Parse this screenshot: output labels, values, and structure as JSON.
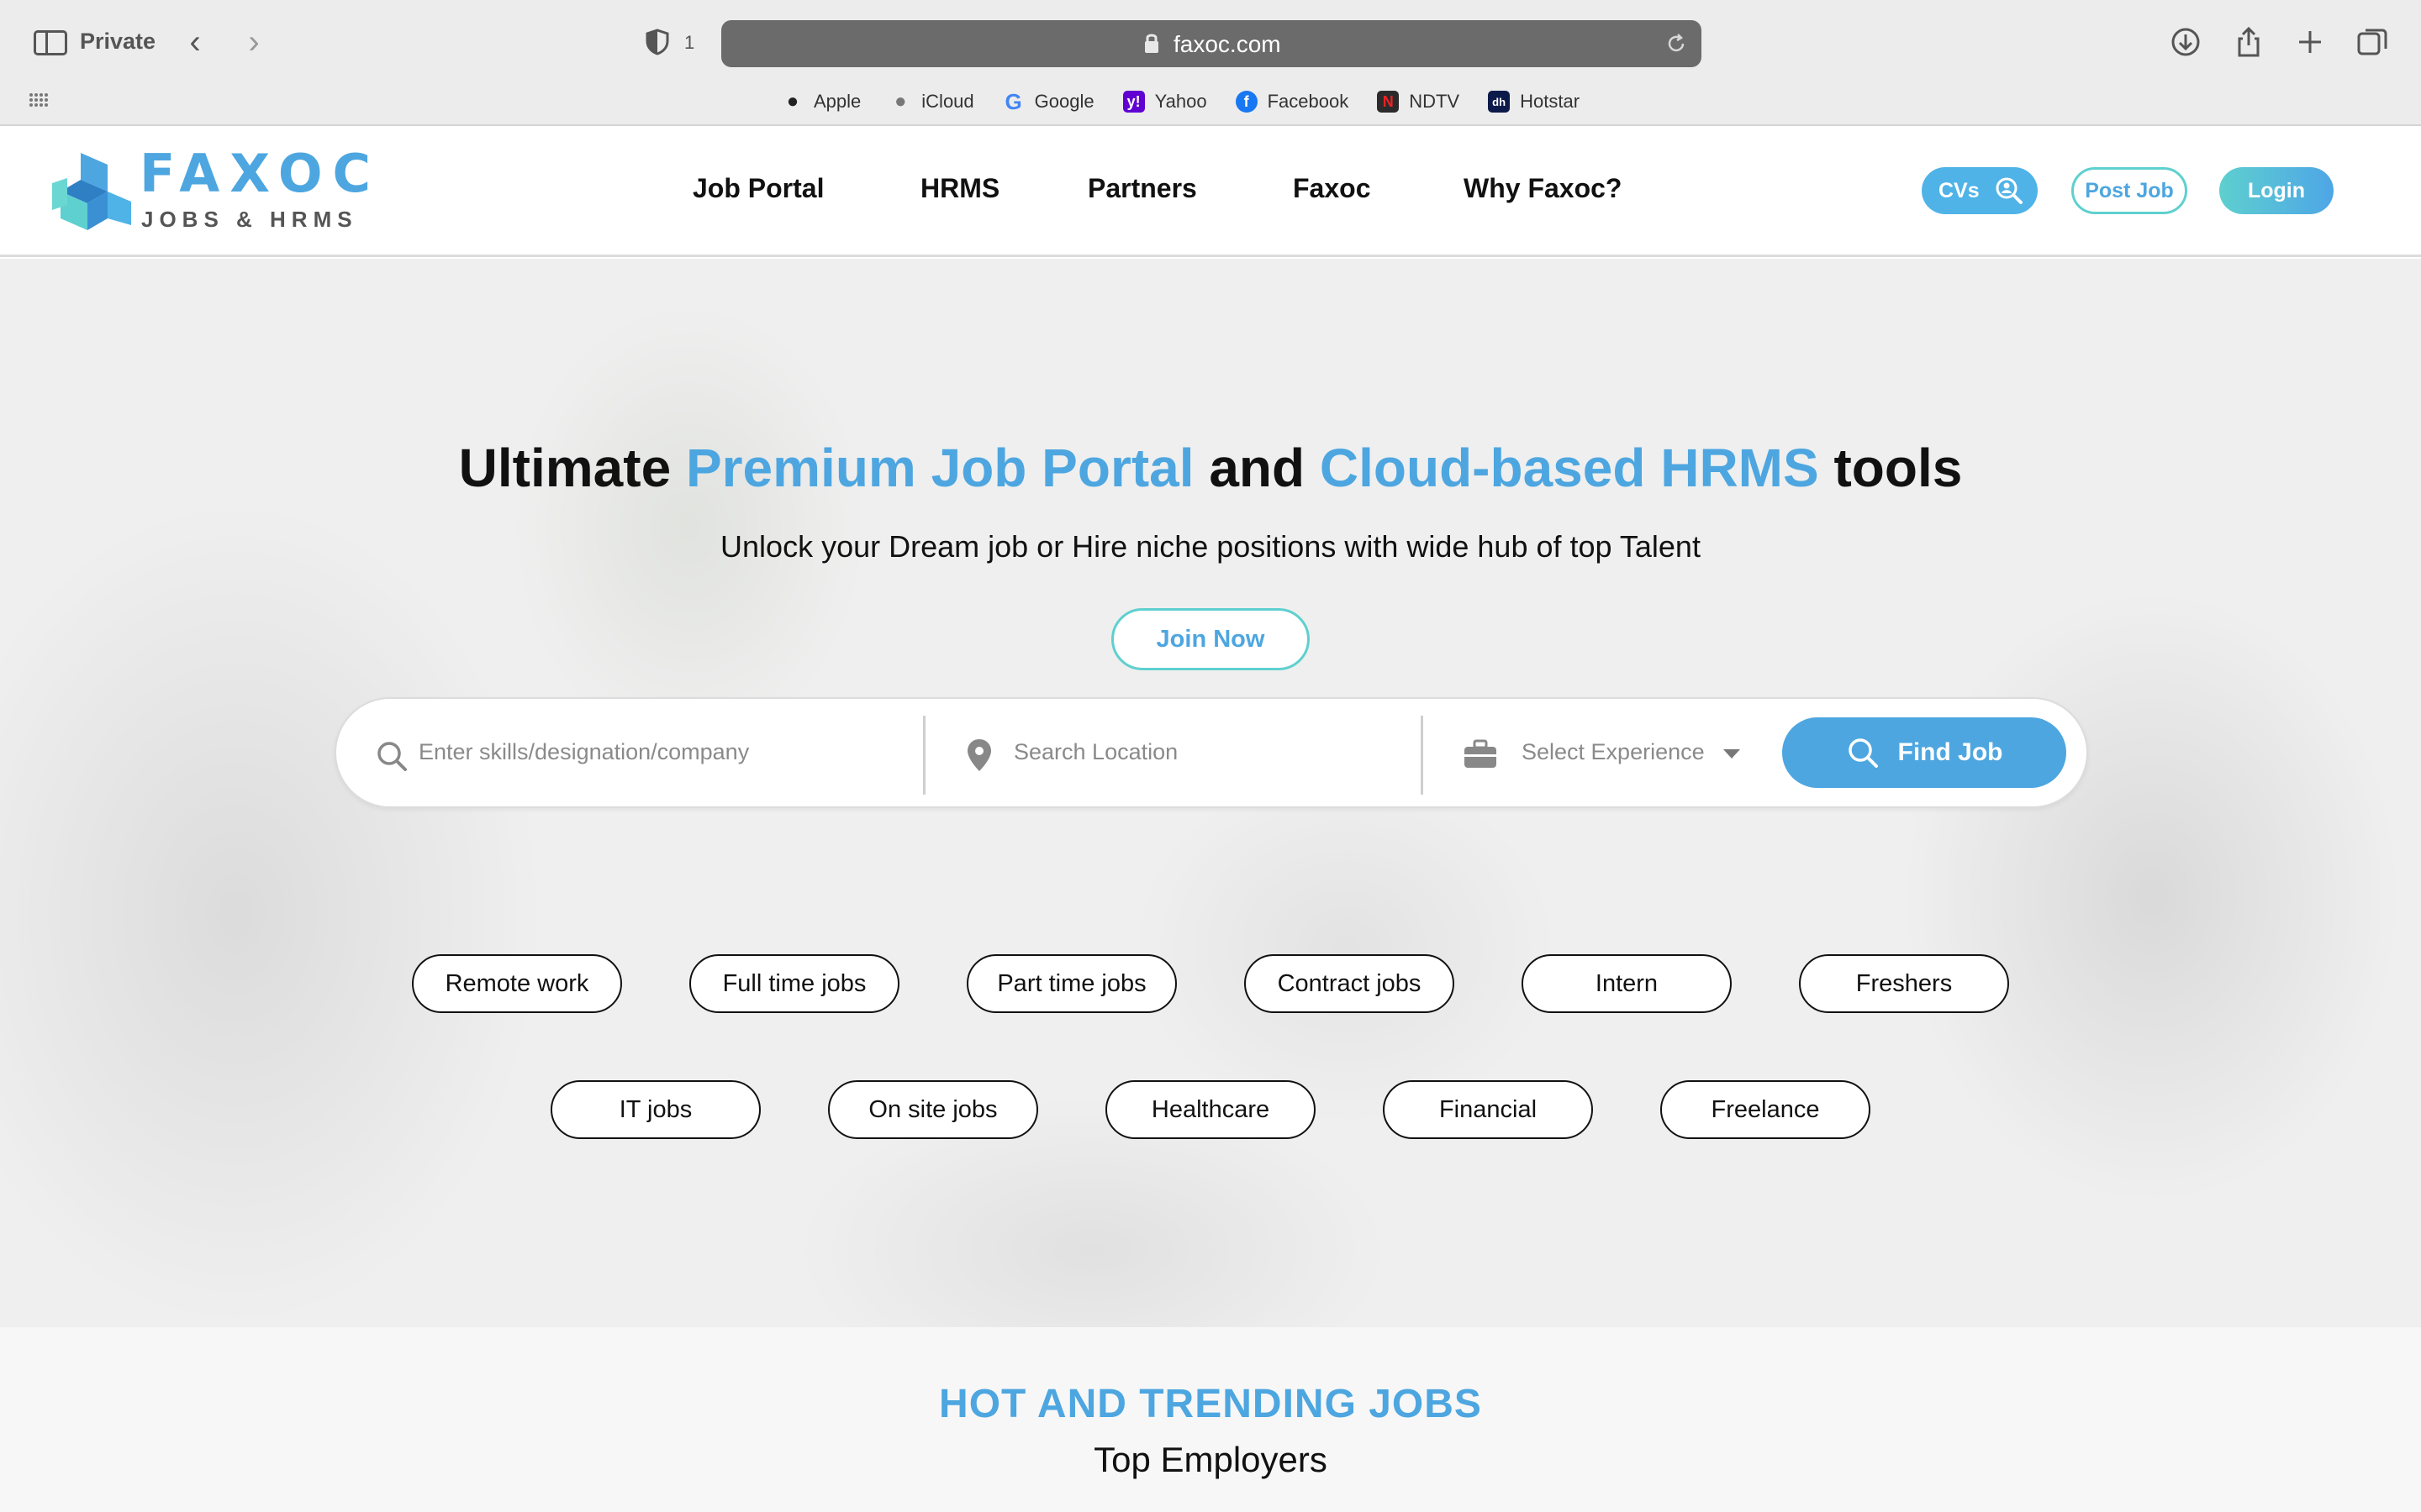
{
  "browser": {
    "window_label": "Private",
    "shield_count": "1",
    "url": "faxoc.com",
    "bookmarks": [
      {
        "label": "Apple",
        "icon": "apple-icon"
      },
      {
        "label": "iCloud",
        "icon": "apple-icon"
      },
      {
        "label": "Google",
        "icon": "google-icon"
      },
      {
        "label": "Yahoo",
        "icon": "yahoo-icon"
      },
      {
        "label": "Facebook",
        "icon": "facebook-icon"
      },
      {
        "label": "NDTV",
        "icon": "ndtv-icon"
      },
      {
        "label": "Hotstar",
        "icon": "hotstar-icon"
      }
    ]
  },
  "header": {
    "logo_word": "FAXOC",
    "logo_sub": "JOBS & HRMS",
    "nav": [
      "Job Portal",
      "HRMS",
      "Partners",
      "Faxoc",
      "Why Faxoc?"
    ],
    "cvs_label": "CVs",
    "post_job_label": "Post Job",
    "login_label": "Login"
  },
  "hero": {
    "title_parts": {
      "p1": "Ultimate ",
      "h1": "Premium Job Portal",
      "p2": " and ",
      "h2": "Cloud-based HRMS",
      "p3": " tools"
    },
    "subtitle": "Unlock your Dream job or Hire niche positions with wide hub of top Talent",
    "join_label": "Join Now",
    "search": {
      "skills_placeholder": "Enter skills/designation/company",
      "location_placeholder": "Search Location",
      "experience_placeholder": "Select Experience",
      "find_label": "Find Job"
    },
    "chips": [
      "Remote work",
      "Full time jobs",
      "Part time jobs",
      "Contract jobs",
      "Intern",
      "Freshers",
      "IT jobs",
      "On site jobs",
      "Healthcare",
      "Financial",
      "Freelance"
    ]
  },
  "trending": {
    "title": "HOT AND TRENDING JOBS",
    "subtitle": "Top Employers"
  },
  "colors": {
    "accent_blue": "#4da6e0",
    "accent_teal": "#5ed0cf",
    "url_bar": "#6b6b6b"
  }
}
